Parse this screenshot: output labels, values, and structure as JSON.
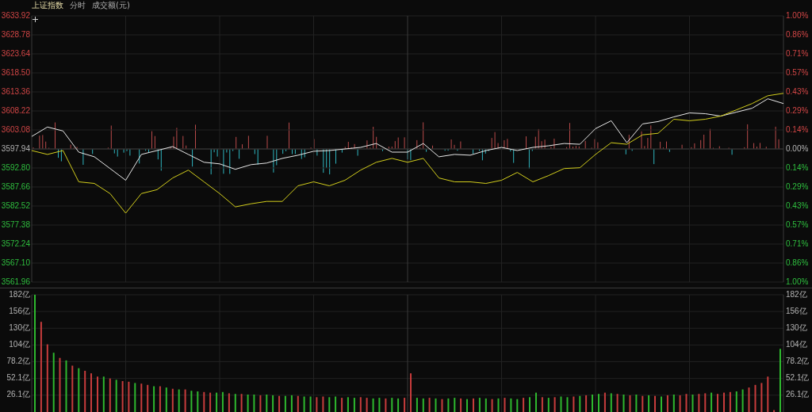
{
  "header": {
    "title": "上证指数",
    "mode": "分时",
    "indicator": "成交额(元)"
  },
  "price_chart": {
    "chart_data": {
      "type": "line",
      "grid": true,
      "categories": [
        null,
        null,
        null,
        null,
        null,
        null,
        null,
        null,
        null,
        null,
        null,
        null,
        null,
        null,
        null,
        null,
        null,
        null,
        null,
        null,
        null,
        null,
        null,
        null,
        null,
        null,
        null,
        null,
        null,
        null,
        null,
        null,
        null,
        null,
        null,
        null,
        null,
        null,
        null,
        null,
        null,
        null,
        null,
        null,
        null,
        null,
        null,
        null,
        null
      ],
      "ylim": [
        3561.96,
        3633.92
      ],
      "yticks": [
        {
          "value": 3633.92,
          "label": "3633.92"
        },
        {
          "value": 3628.78,
          "label": "3628.78"
        },
        {
          "value": 3623.64,
          "label": "3623.64"
        },
        {
          "value": 3618.5,
          "label": "3618.50"
        },
        {
          "value": 3613.36,
          "label": "3613.36"
        },
        {
          "value": 3608.22,
          "label": "3608.22"
        },
        {
          "value": 3603.08,
          "label": "3603.08"
        },
        {
          "value": 3597.94,
          "label": "3597.94"
        },
        {
          "value": 3592.8,
          "label": "3592.80"
        },
        {
          "value": 3587.66,
          "label": "3587.66"
        },
        {
          "value": 3582.52,
          "label": "3582.52"
        },
        {
          "value": 3577.38,
          "label": "3577.38"
        },
        {
          "value": 3572.24,
          "label": "3572.24"
        },
        {
          "value": 3567.1,
          "label": "3567.10"
        },
        {
          "value": 3561.96,
          "label": "3561.96"
        }
      ],
      "series": [
        {
          "color": "#e8e8e8",
          "values": [
            3601.33,
            3603.87,
            3602.81,
            3597.09,
            3595.82,
            3592.65,
            3589.48,
            3596.46,
            3597.52,
            3598.58,
            3596.46,
            3594.34,
            3593.92,
            3592.44,
            3593.71,
            3594.13,
            3595.4,
            3596.25,
            3597.31,
            3597.52,
            3597.94,
            3598.36,
            3599.42,
            3597.09,
            3597.09,
            3599.42,
            3595.82,
            3596.46,
            3596.25,
            3597.52,
            3598.36,
            3597.52,
            3598.36,
            3598.79,
            3599.42,
            3599.21,
            3603.44,
            3605.56,
            3599.63,
            3604.71,
            3605.35,
            3606.62,
            3607.68,
            3607.46,
            3606.83,
            3607.89,
            3608.95,
            3611.49,
            3610.22
          ]
        },
        {
          "color": "#d4cf1c",
          "values": [
            3597.52,
            3596.46,
            3597.52,
            3589.05,
            3588.63,
            3585.88,
            3580.59,
            3585.88,
            3586.94,
            3590.11,
            3592.23,
            3589.05,
            3585.88,
            3582.28,
            3583.13,
            3583.76,
            3583.76,
            3587.99,
            3589.05,
            3587.99,
            3589.48,
            3592.23,
            3594.34,
            3595.4,
            3594.34,
            3595.4,
            3590.11,
            3589.05,
            3589.05,
            3588.63,
            3589.48,
            3591.59,
            3589.05,
            3590.75,
            3592.65,
            3592.86,
            3596.46,
            3599.63,
            3599.21,
            3601.75,
            3602.17,
            3605.98,
            3605.56,
            3605.98,
            3606.83,
            3608.52,
            3610.22,
            3612.33,
            3612.97
          ]
        }
      ]
    },
    "right_axis_labels": [
      "1.00%",
      "0.86%",
      "0.71%",
      "0.57%",
      "0.43%",
      "0.29%",
      "0.14%",
      "0.00%",
      "0.14%",
      "0.29%",
      "0.43%",
      "0.57%",
      "0.71%",
      "0.86%",
      "1.00%"
    ]
  },
  "volume_chart": {
    "chart_data": {
      "type": "bar",
      "grid": true,
      "ylim": [
        0,
        182
      ],
      "yticks": [
        {
          "value": 182,
          "label": "182亿"
        },
        {
          "value": 156,
          "label": "156亿"
        },
        {
          "value": 130,
          "label": "130亿"
        },
        {
          "value": 104,
          "label": "104亿"
        },
        {
          "value": 78.2,
          "label": "78.2亿"
        },
        {
          "value": 52.1,
          "label": "52.1亿"
        },
        {
          "value": 26.1,
          "label": "26.1亿"
        }
      ],
      "series": [
        {
          "color": "#c83c3c",
          "values": [
            null,
            140,
            105,
            null,
            84,
            null,
            72,
            null,
            64,
            60,
            55,
            null,
            52,
            null,
            48,
            47,
            null,
            44,
            42,
            null,
            40,
            null,
            36,
            null,
            35,
            null,
            null,
            31,
            30,
            null,
            null,
            29,
            null,
            28,
            null,
            null,
            26,
            null,
            null,
            25,
            null,
            null,
            25,
            null,
            null,
            23,
            24,
            null,
            null,
            22,
            null,
            null,
            23,
            22,
            null,
            null,
            21,
            null,
            null,
            22,
            60,
            null,
            null,
            22,
            null,
            20,
            null,
            null,
            21,
            null,
            21,
            null,
            null,
            20,
            null,
            22,
            null,
            null,
            22,
            null,
            null,
            23,
            null,
            23,
            null,
            null,
            24,
            null,
            26,
            null,
            null,
            30,
            null,
            28,
            null,
            26,
            null,
            25,
            null,
            25,
            null,
            26,
            null,
            26,
            28,
            null,
            28,
            29,
            null,
            28,
            30,
            31,
            null,
            null,
            38,
            42,
            45,
            55,
            3,
            null
          ]
        },
        {
          "color": "#2eb82e",
          "values": [
            182,
            null,
            null,
            92,
            null,
            80,
            null,
            68,
            null,
            null,
            null,
            55,
            null,
            50,
            null,
            null,
            45,
            null,
            null,
            40,
            null,
            38,
            null,
            35,
            null,
            33,
            32,
            null,
            null,
            30,
            31,
            null,
            28,
            null,
            27,
            27,
            null,
            27,
            26,
            null,
            25,
            26,
            null,
            24,
            24,
            null,
            null,
            23,
            24,
            null,
            23,
            22,
            null,
            null,
            21,
            22,
            null,
            22,
            21,
            null,
            null,
            22,
            21,
            null,
            21,
            null,
            21,
            22,
            null,
            20,
            null,
            22,
            21,
            null,
            21,
            null,
            21,
            20,
            null,
            23,
            30,
            null,
            22,
            null,
            24,
            23,
            null,
            25,
            null,
            27,
            28,
            null,
            29,
            null,
            27,
            null,
            27,
            null,
            26,
            null,
            24,
            null,
            27,
            null,
            null,
            27,
            null,
            null,
            30,
            null,
            null,
            null,
            32,
            35,
            null,
            null,
            null,
            null,
            null,
            98
          ]
        }
      ]
    },
    "right_axis_labels": [
      "182亿",
      "156亿",
      "130亿",
      "104亿",
      "78.2亿",
      "52.1亿",
      "26.1亿"
    ]
  }
}
